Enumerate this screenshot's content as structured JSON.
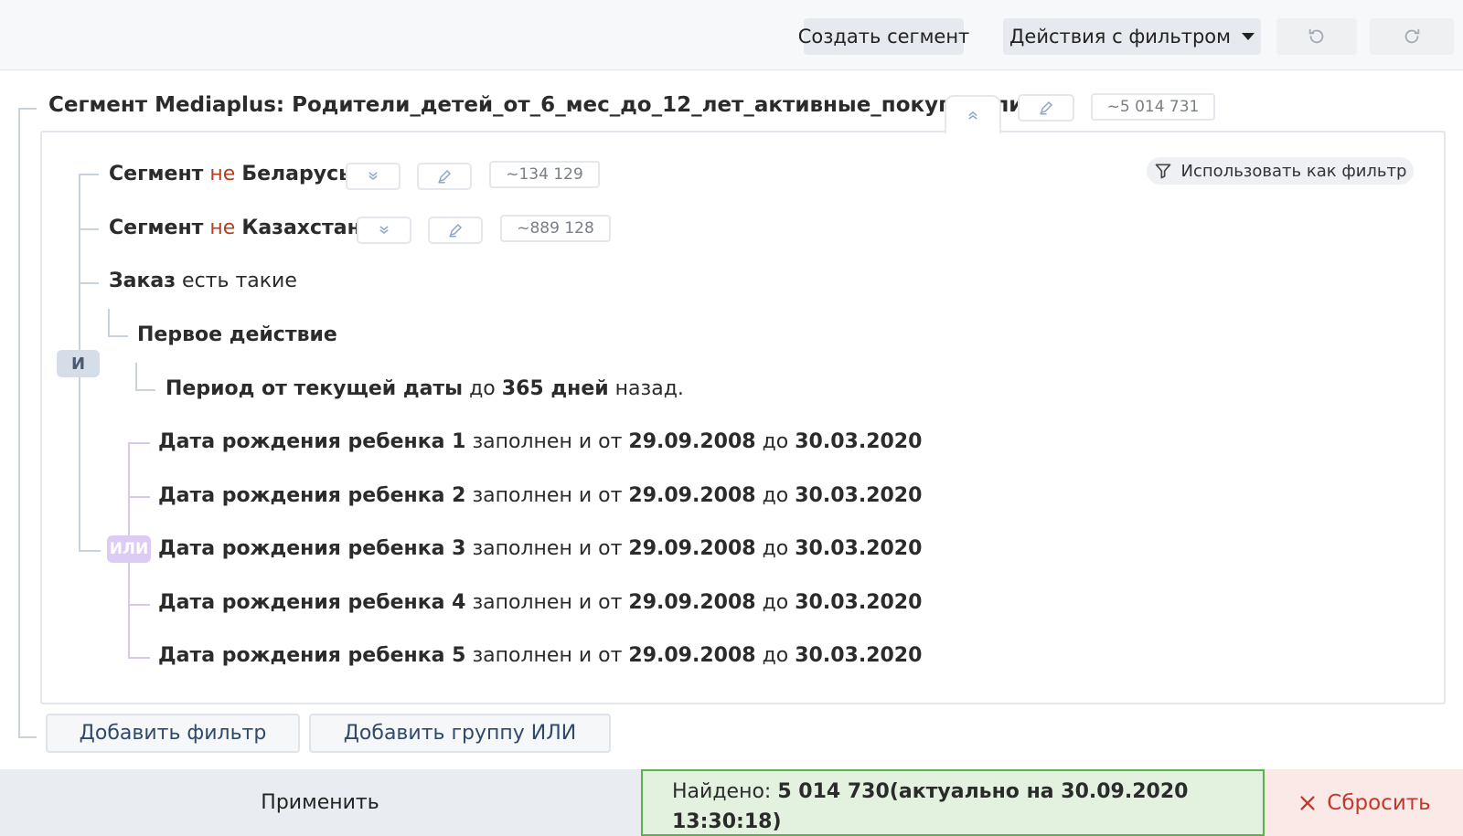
{
  "toolbar": {
    "create_segment_label": "Создать сегмент",
    "filter_actions_label": "Действия с фильтром",
    "undo_icon": "undo-icon",
    "redo_icon": "redo-icon"
  },
  "segment": {
    "title": "Сегмент Mediaplus: Родители_детей_от_6_мес_до_12_лет_активные_покупатели_РФ",
    "count": "~5 014 731"
  },
  "use_as_filter_label": "Использовать как фильтр",
  "conditions": {
    "belarus": {
      "prefix": "Сегмент",
      "neg": "не",
      "name": "Беларусь",
      "count": "~134 129"
    },
    "kazakhstan": {
      "prefix": "Сегмент",
      "neg": "не",
      "name": "Казахстан",
      "count": "~889 128"
    },
    "order": {
      "name": "Заказ",
      "rest": "есть такие"
    },
    "first_action": "Первое действие",
    "period": {
      "label": "Период от текущей даты",
      "mid": "до",
      "value": "365 дней",
      "tail": "назад."
    },
    "and_label": "И",
    "or_label": "ИЛИ",
    "birthdates": [
      {
        "label": "Дата рождения ребенка 1",
        "mid": "заполнен и от",
        "from": "29.09.2008",
        "to_word": "до",
        "to": "30.03.2020"
      },
      {
        "label": "Дата рождения ребенка 2",
        "mid": "заполнен и от",
        "from": "29.09.2008",
        "to_word": "до",
        "to": "30.03.2020"
      },
      {
        "label": "Дата рождения ребенка 3",
        "mid": "заполнен и от",
        "from": "29.09.2008",
        "to_word": "до",
        "to": "30.03.2020"
      },
      {
        "label": "Дата рождения ребенка 4",
        "mid": "заполнен и от",
        "from": "29.09.2008",
        "to_word": "до",
        "to": "30.03.2020"
      },
      {
        "label": "Дата рождения ребенка 5",
        "mid": "заполнен и от",
        "from": "29.09.2008",
        "to_word": "до",
        "to": "30.03.2020"
      }
    ]
  },
  "add_filter_label": "Добавить фильтр",
  "add_or_group_label": "Добавить группу ИЛИ",
  "bottom": {
    "apply_label": "Применить",
    "found_prefix": "Найдено:",
    "found_value": "5 014 730(актуально на 30.09.2020 13:30:18)",
    "reset_label": "Сбросить"
  },
  "colors": {
    "negation": "#b3401f",
    "found_border": "#58b34b",
    "reset_text": "#c0392b",
    "or_badge": "#dccbf2"
  }
}
